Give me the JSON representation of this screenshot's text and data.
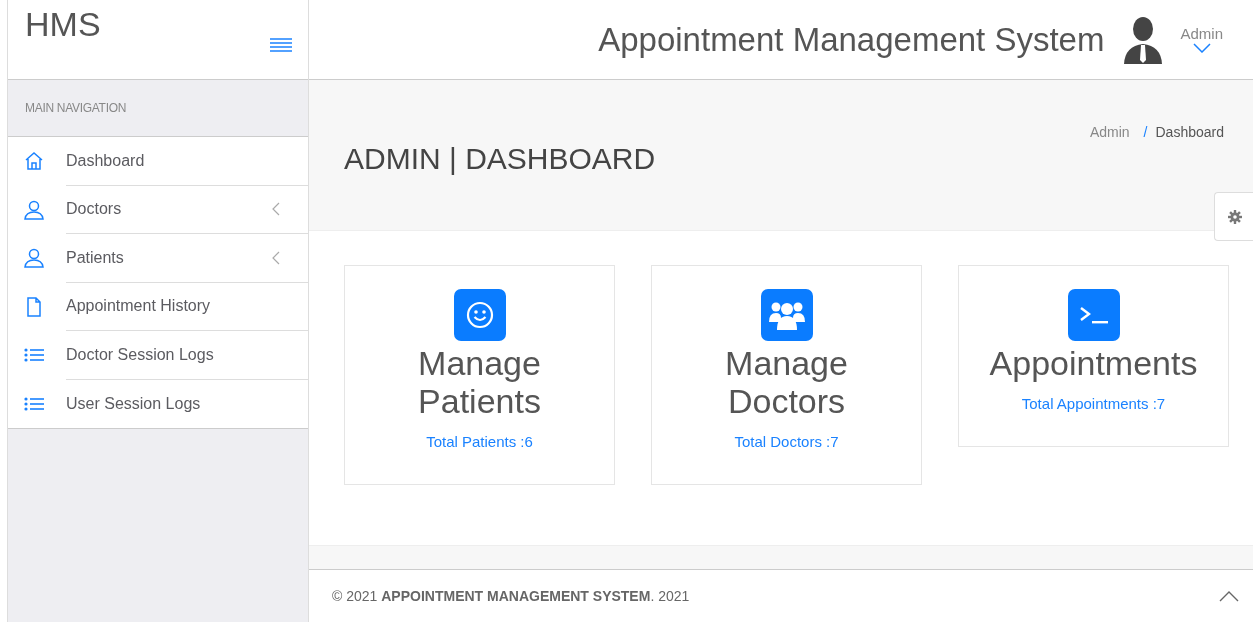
{
  "sidebar": {
    "logo": "HMS",
    "section_title": "MAIN NAVIGATION",
    "items": [
      {
        "label": "Dashboard",
        "kind": "home",
        "has_submenu": false
      },
      {
        "label": "Doctors",
        "kind": "user",
        "has_submenu": true
      },
      {
        "label": "Patients",
        "kind": "user",
        "has_submenu": true
      },
      {
        "label": "Appointment History",
        "kind": "file",
        "has_submenu": false
      },
      {
        "label": "Doctor Session Logs",
        "kind": "list",
        "has_submenu": false
      },
      {
        "label": "User Session Logs",
        "kind": "list",
        "has_submenu": false
      }
    ]
  },
  "header": {
    "title": "Appointment Management System",
    "user": "Admin"
  },
  "page": {
    "title": "ADMIN | DASHBOARD",
    "breadcrumb": [
      "Admin",
      "Dashboard"
    ],
    "breadcrumb_separator": "/"
  },
  "cards": [
    {
      "kind": "smile",
      "title": "Manage Patients",
      "link": "Total Patients :6"
    },
    {
      "kind": "users",
      "title": "Manage Doctors",
      "link": "Total Doctors :7"
    },
    {
      "kind": "terminal",
      "title": "Appointments",
      "link": "Total Appointments :7"
    }
  ],
  "footer": {
    "text": "© 2021 **APPOINTMENT MANAGEMENT SYSTEM**. 2021"
  }
}
